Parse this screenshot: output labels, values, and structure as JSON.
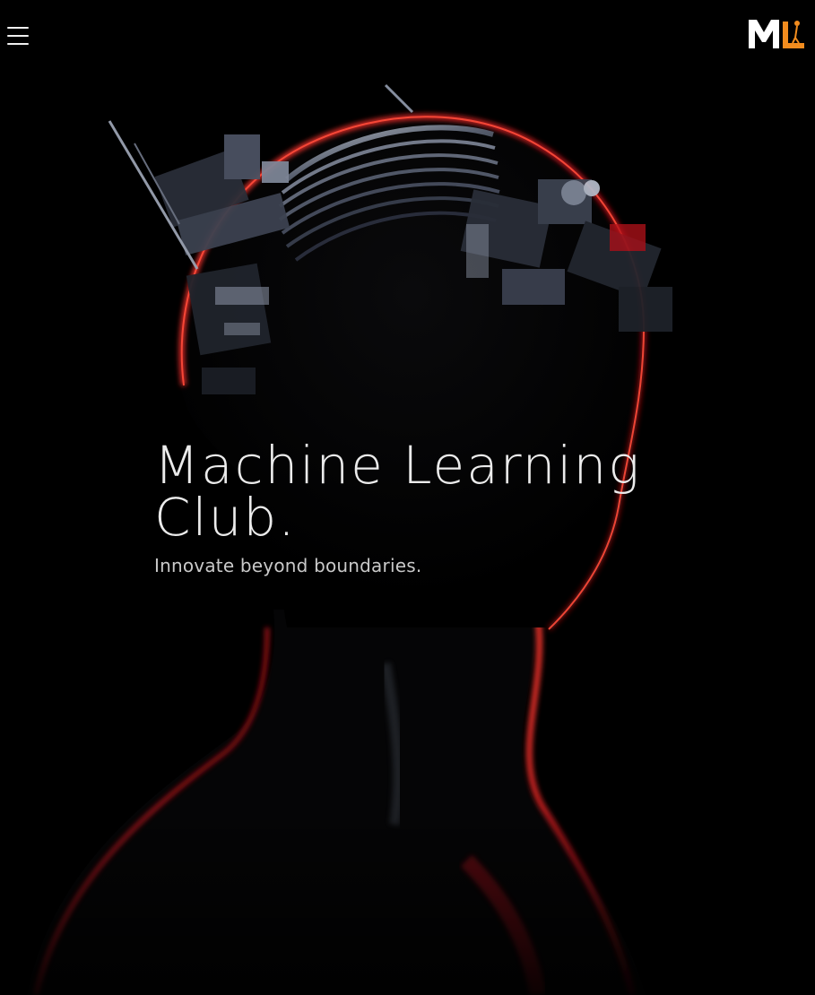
{
  "header": {
    "menu_icon": "hamburger-menu-icon",
    "logo_text": "ML",
    "logo_colors": {
      "primary": "#ffffff",
      "accent": "#f28c1e"
    }
  },
  "hero": {
    "title": "Machine Learning Club.",
    "tagline": "Innovate beyond boundaries.",
    "background": "dark android head silhouette with red rim light and mechanical parts",
    "colors": {
      "background": "#000000",
      "rim_light": "#c4161c",
      "metal": "#8d96a8",
      "text": "#ebebeb"
    }
  }
}
